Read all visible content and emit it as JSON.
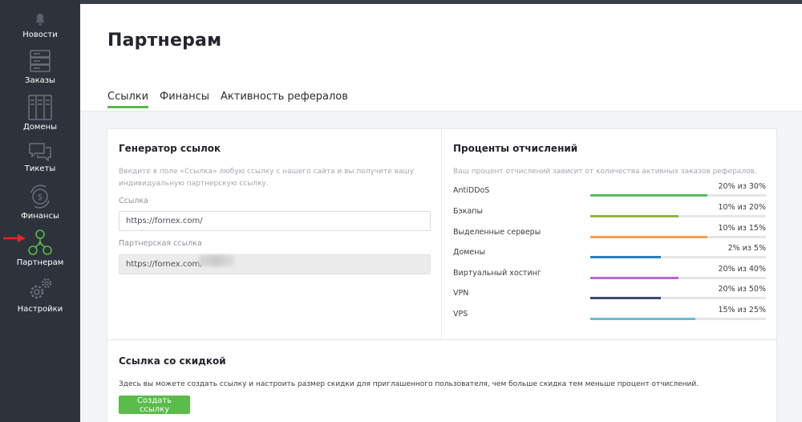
{
  "sidebar": {
    "items": [
      {
        "label": "Новости",
        "icon": "bell-icon"
      },
      {
        "label": "Заказы",
        "icon": "server-rack-icon"
      },
      {
        "label": "Домены",
        "icon": "domains-icon"
      },
      {
        "label": "Тикеты",
        "icon": "chat-icon"
      },
      {
        "label": "Финансы",
        "icon": "finance-icon"
      },
      {
        "label": "Партнерам",
        "icon": "partners-icon"
      },
      {
        "label": "Настройки",
        "icon": "gears-icon"
      }
    ],
    "active": "Партнерам"
  },
  "header": {
    "title": "Партнерам",
    "tabs": [
      {
        "label": "Ссылки",
        "active": true
      },
      {
        "label": "Финансы",
        "active": false
      },
      {
        "label": "Активность рефералов",
        "active": false
      }
    ]
  },
  "generator": {
    "title": "Генератор ссылок",
    "hint_line1": "Введите в поле «Ссылка» любую ссылку с нашего сайта и вы получите вашу",
    "hint_line2": "индивидуальную партнерскую ссылку.",
    "link_label": "Ссылка",
    "link_value": "https://fornex.com/",
    "partner_label": "Партнерская ссылка",
    "partner_value": "https://fornex.com/"
  },
  "percentages": {
    "title": "Проценты отчислений",
    "hint": "Ваш процент отчислений зависит от количества активных заказов рефералов.",
    "rows": [
      {
        "name": "AntiDDoS",
        "value": "20% из 30%",
        "fraction": 0.667,
        "color": "#5bbb62"
      },
      {
        "name": "Бэкапы",
        "value": "10% из 20%",
        "fraction": 0.5,
        "color": "#8db83e"
      },
      {
        "name": "Выделенные серверы",
        "value": "10% из 15%",
        "fraction": 0.667,
        "color": "#f0a050"
      },
      {
        "name": "Домены",
        "value": "2% из 5%",
        "fraction": 0.4,
        "color": "#2a7fb8"
      },
      {
        "name": "Виртуальный хостинг",
        "value": "20% из 40%",
        "fraction": 0.5,
        "color": "#b36ad1"
      },
      {
        "name": "VPN",
        "value": "20% из 50%",
        "fraction": 0.4,
        "color": "#3f4a6e"
      },
      {
        "name": "VPS",
        "value": "15% из 25%",
        "fraction": 0.6,
        "color": "#6bbcd0"
      }
    ]
  },
  "discount": {
    "title": "Ссылка со скидкой",
    "hint": "Здесь вы можете создать ссылку и настроить размер скидки для приглашенного пользователя, чем больше скидка тем меньше процент отчислений.",
    "button_label": "Создать ссылку"
  },
  "colors": {
    "accent": "#5bbb4b",
    "sidebar": "#2e333b",
    "arrow": "#e3262b"
  }
}
